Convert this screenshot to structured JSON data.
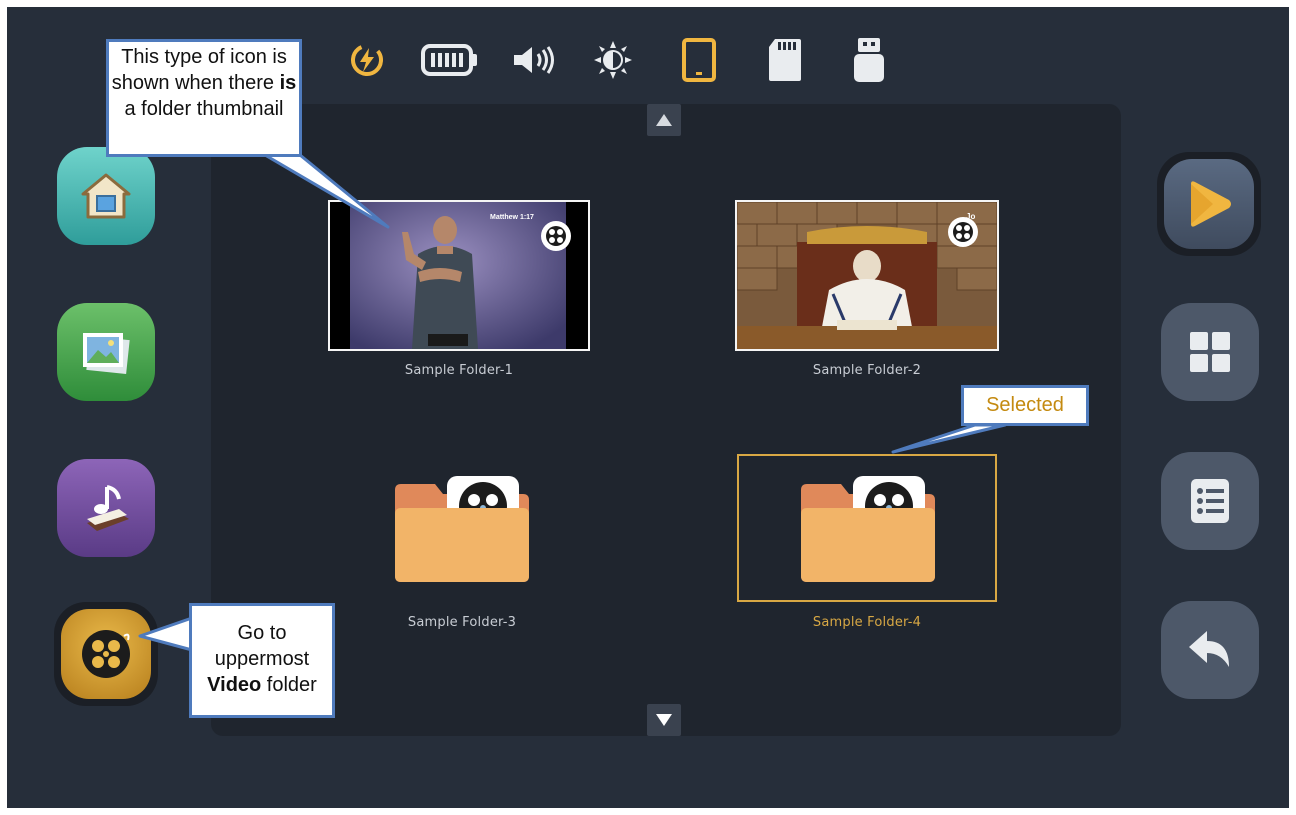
{
  "status_bar": {
    "icons": [
      "lightning-icon",
      "battery-icon",
      "volume-icon",
      "brightness-icon",
      "tablet-icon",
      "sd-card-icon",
      "usb-drive-icon"
    ],
    "accent_color": "#f0b640"
  },
  "folders": [
    {
      "name": "Sample Folder-1",
      "has_thumbnail": true,
      "thumb_caption": "Matthew 1:17"
    },
    {
      "name": "Sample Folder-2",
      "has_thumbnail": true,
      "thumb_caption": "Jo"
    },
    {
      "name": "Sample Folder-3",
      "has_thumbnail": false
    },
    {
      "name": "Sample Folder-4",
      "has_thumbnail": false,
      "selected": true
    }
  ],
  "left_nav": [
    "home-button",
    "photos-button",
    "music-button",
    "video-button"
  ],
  "right_nav": [
    "play-button",
    "grid-view-button",
    "list-view-button",
    "back-button"
  ],
  "callouts": {
    "thumbnail_note": {
      "pre": "This type of icon is shown when there ",
      "bold": "is",
      "post": " a folder thumbnail"
    },
    "selected_note": "Selected",
    "video_note": {
      "pre": "Go to uppermost ",
      "bold": "Video",
      "post": " folder"
    }
  },
  "colors": {
    "background": "#262e3a",
    "panel": "#1f252e",
    "selected": "#d8a844",
    "callout_border": "#4f7bbd"
  }
}
